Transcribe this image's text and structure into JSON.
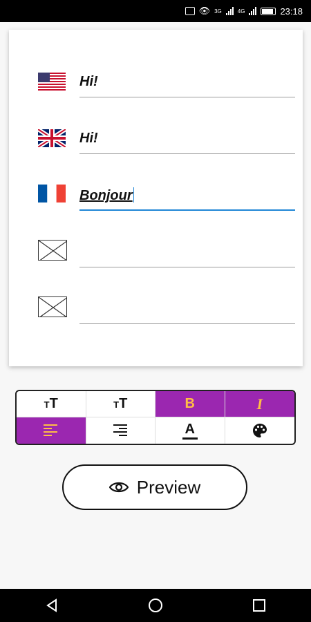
{
  "status_bar": {
    "time": "23:18",
    "net1": "3G",
    "net2": "4G"
  },
  "entries": [
    {
      "flag_icon": "us-flag-icon",
      "value": "Hi!"
    },
    {
      "flag_icon": "uk-flag-icon",
      "value": "Hi!"
    },
    {
      "flag_icon": "france-flag-icon",
      "value": "Bonjour"
    },
    {
      "flag_icon": "missing-image-icon",
      "value": ""
    },
    {
      "flag_icon": "missing-image-icon",
      "value": ""
    }
  ],
  "toolbar": {
    "accent": "#9b27b0",
    "accent_text": "#ffbe45",
    "buttons": [
      {
        "name": "text-size-increase-button",
        "label": "ᴛT",
        "active": false
      },
      {
        "name": "text-size-decrease-button",
        "label": "ᴛT",
        "active": false
      },
      {
        "name": "bold-button",
        "label": "B",
        "active": true
      },
      {
        "name": "italic-button",
        "label": "I",
        "active": true
      },
      {
        "name": "align-left-button",
        "label": "",
        "active": true
      },
      {
        "name": "align-right-button",
        "label": "",
        "active": false
      },
      {
        "name": "text-color-button",
        "label": "A",
        "active": false
      },
      {
        "name": "palette-button",
        "label": "",
        "active": false
      }
    ]
  },
  "preview_button": {
    "label": "Preview"
  },
  "active_field_color": "#1f86d6"
}
